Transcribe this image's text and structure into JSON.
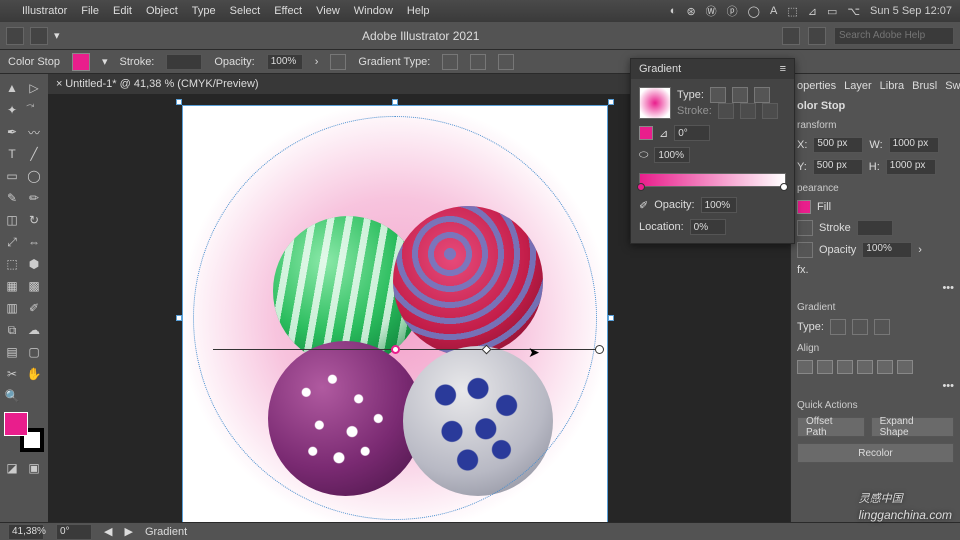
{
  "menubar": {
    "items": [
      "Illustrator",
      "File",
      "Edit",
      "Object",
      "Type",
      "Select",
      "Effect",
      "View",
      "Window",
      "Help"
    ],
    "clock": "Sun 5 Sep  12:07"
  },
  "appbar": {
    "title": "Adobe Illustrator 2021",
    "search_placeholder": "Search Adobe Help"
  },
  "controlbar": {
    "label": "Color Stop",
    "stroke_label": "Stroke:",
    "opacity_label": "Opacity:",
    "opacity_value": "100%",
    "grad_type_label": "Gradient Type:"
  },
  "tab": {
    "title": "Untitled-1* @ 41,38 % (CMYK/Preview)",
    "close": "×"
  },
  "gradient_panel": {
    "title": "Gradient",
    "type_label": "Type:",
    "stroke_label": "Stroke:",
    "angle_value": "0°",
    "aspect_value": "100%",
    "opacity_label": "Opacity:",
    "opacity_value": "100%",
    "location_label": "Location:",
    "location_value": "0%"
  },
  "properties": {
    "tabs": [
      "operties",
      "Layer",
      "Libra",
      "Brusl",
      "Swat"
    ],
    "section_colorstop": "olor Stop",
    "section_transform": "ransform",
    "x_label": "X:",
    "x_value": "500 px",
    "y_label": "Y:",
    "y_value": "500 px",
    "w_label": "W:",
    "w_value": "1000 px",
    "h_label": "H:",
    "h_value": "1000 px",
    "section_appearance": "pearance",
    "fill_label": "Fill",
    "stroke_label": "Stroke",
    "opacity_label": "Opacity",
    "opacity_value": "100%",
    "fx_label": "fx.",
    "section_gradient": "Gradient",
    "grad_type_label": "Type:",
    "section_align": "Align",
    "section_quick": "Quick Actions",
    "btn_offset": "Offset Path",
    "btn_expand": "Expand Shape",
    "btn_recolor": "Recolor"
  },
  "statusbar": {
    "zoom": "41,38%",
    "rotate": "0°",
    "tool": "Gradient"
  },
  "watermark": {
    "brand": "灵感中国",
    "url": "lingganchina.com"
  }
}
